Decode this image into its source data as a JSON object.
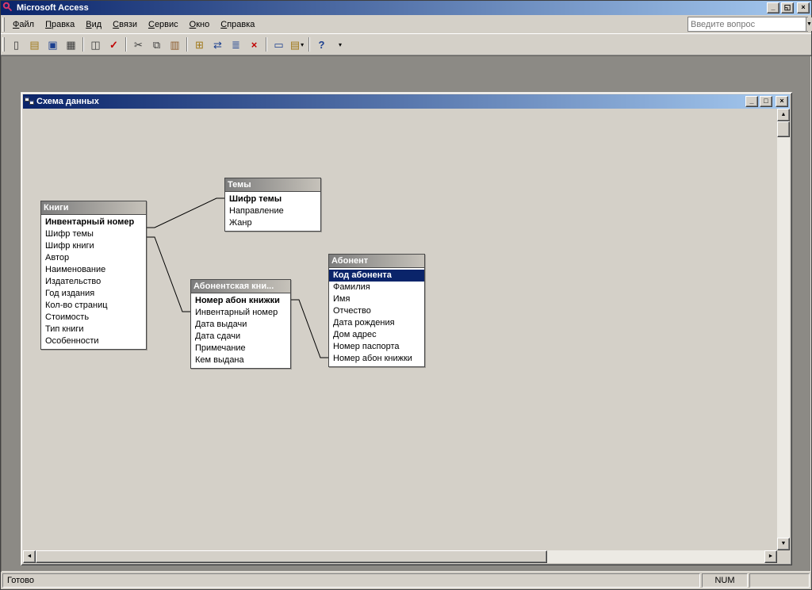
{
  "colors": {
    "titlebar_start": "#0a246a",
    "titlebar_end": "#a6caf0",
    "chrome": "#d4d0c8",
    "mdi_background": "#8c8a85",
    "selection": "#0a246a",
    "table_body": "#ffffff"
  },
  "app": {
    "title": "Microsoft Access",
    "window_buttons": {
      "minimize": "_",
      "restore": "◱",
      "close": "×"
    }
  },
  "menu": {
    "items": [
      "Файл",
      "Правка",
      "Вид",
      "Связи",
      "Сервис",
      "Окно",
      "Справка"
    ],
    "question_box_placeholder": "Введите вопрос"
  },
  "toolbar": {
    "dropdown_arrow": "▾",
    "buttons": [
      {
        "name": "new",
        "glyph": "▯"
      },
      {
        "name": "open",
        "glyph": "▤"
      },
      {
        "name": "save",
        "glyph": "▣"
      },
      {
        "name": "print",
        "glyph": "▦"
      },
      {
        "name": "print-preview",
        "glyph": "◫"
      },
      {
        "name": "spelling",
        "glyph": "✓"
      },
      {
        "name": "cut",
        "glyph": "✂"
      },
      {
        "name": "copy",
        "glyph": "⧉"
      },
      {
        "name": "paste",
        "glyph": "▥"
      },
      {
        "name": "show-table",
        "glyph": "⊞"
      },
      {
        "name": "direct-relationships",
        "glyph": "⇄"
      },
      {
        "name": "all-relationships",
        "glyph": "≣"
      },
      {
        "name": "clear-layout",
        "glyph": "×"
      },
      {
        "name": "database-window",
        "glyph": "▭"
      },
      {
        "name": "new-object",
        "glyph": "▤"
      },
      {
        "name": "help",
        "glyph": "?"
      }
    ]
  },
  "schema_window": {
    "title": "Схема данных",
    "window_buttons": {
      "minimize": "_",
      "maximize": "□",
      "close": "×"
    },
    "tables": [
      {
        "name": "Книги",
        "fields": [
          "Инвентарный номер",
          "Шифр темы",
          "Шифр книги",
          "Автор",
          "Наименование",
          "Издательство",
          "Год издания",
          "Кол-во страниц",
          "Стоимость",
          "Тип книги",
          "Особенности"
        ]
      },
      {
        "name": "Темы",
        "fields": [
          "Шифр темы",
          "Направление",
          "Жанр"
        ]
      },
      {
        "name": "Абонентская кни...",
        "fields": [
          "Номер абон книжки",
          "Инвентарный номер",
          "Дата выдачи",
          "Дата сдачи",
          "Примечание",
          "Кем выдана"
        ]
      },
      {
        "name": "Абонент",
        "fields": [
          "Код абонента",
          "Фамилия",
          "Имя",
          "Отчество",
          "Дата рождения",
          "Дом адрес",
          "Номер паспорта",
          "Номер абон книжки"
        ]
      }
    ]
  },
  "statusbar": {
    "message": "Готово",
    "num_lock": "NUM"
  }
}
